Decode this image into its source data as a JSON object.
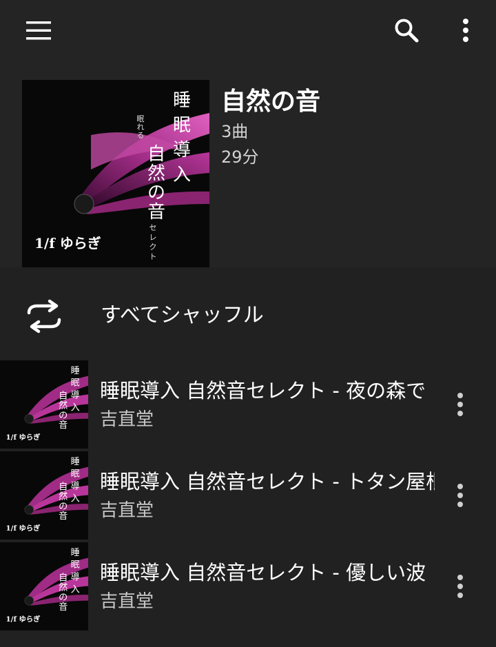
{
  "topbar": {
    "menu_icon": "menu-icon",
    "search_icon": "search-icon",
    "more_icon": "more-vert-icon"
  },
  "album": {
    "title": "自然の音",
    "track_count": "3曲",
    "duration": "29分",
    "art": {
      "line1": "睡",
      "line2": "眠",
      "line3": "導",
      "line4": "入",
      "small_vertical": "眠れる",
      "big_col1": "自然の音",
      "select_vertical": "セレクト",
      "bottom": "1/f ゆらぎ"
    }
  },
  "shuffle": {
    "label": "すべてシャッフル",
    "icon": "shuffle-icon"
  },
  "tracks": [
    {
      "title": "睡眠導入 自然音セレクト - 夜の森で",
      "artist": "吉直堂"
    },
    {
      "title": "睡眠導入 自然音セレクト - トタン屋根",
      "artist": "吉直堂"
    },
    {
      "title": "睡眠導入 自然音セレクト - 優しい波",
      "artist": "吉直堂"
    }
  ],
  "colors": {
    "background": "#212121",
    "header": "#242424",
    "petal": "#c0389a"
  }
}
